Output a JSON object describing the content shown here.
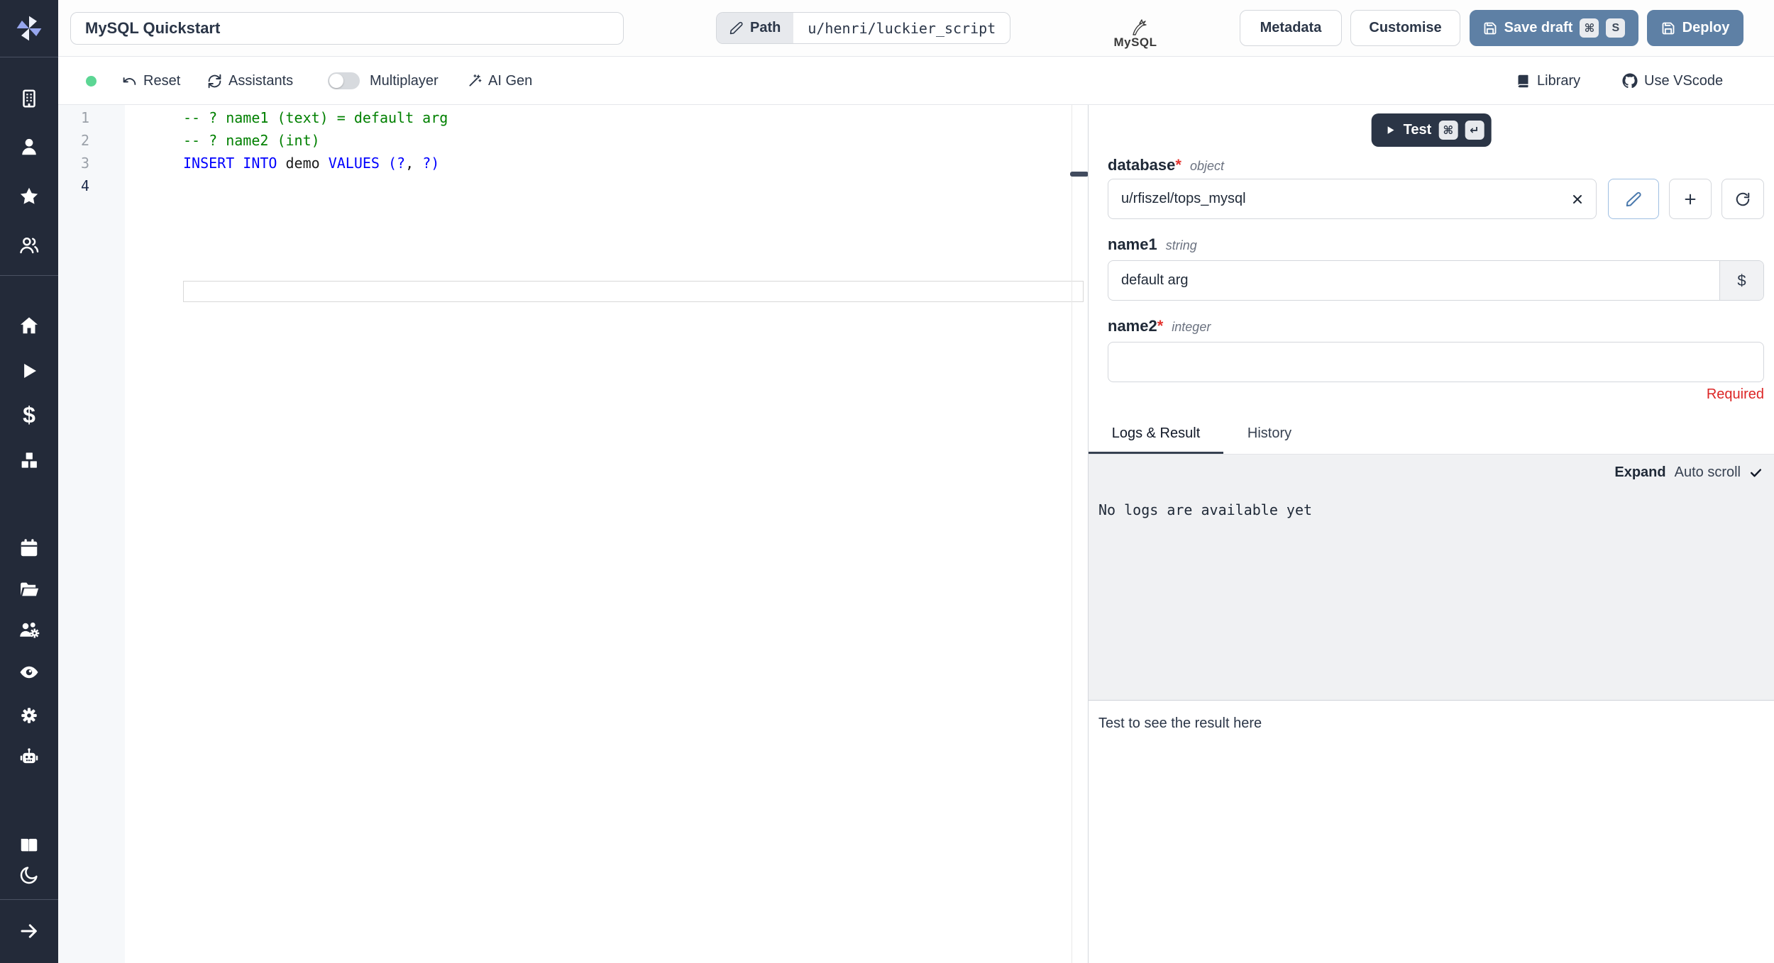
{
  "colors": {
    "accent_blue": "#5e80a5",
    "sidebar_bg": "#232a39",
    "status_dot_green": "#5cd694",
    "comment_green": "#008000",
    "keyword_blue": "#0000ff",
    "required_red": "#dc2626"
  },
  "header": {
    "title_value": "MySQL Quickstart",
    "path_label": "Path",
    "path_value": "u/henri/luckier_script",
    "language_badge": "MySQL",
    "metadata_label": "Metadata",
    "customise_label": "Customise",
    "save_draft_label": "Save draft",
    "save_draft_keys": [
      "⌘",
      "S"
    ],
    "deploy_label": "Deploy"
  },
  "toolbar": {
    "reset_label": "Reset",
    "assistants_label": "Assistants",
    "multiplayer_label": "Multiplayer",
    "multiplayer_on": false,
    "ai_gen_label": "AI Gen",
    "library_label": "Library",
    "vscode_label": "Use VScode"
  },
  "sidebar": {
    "icons": [
      "windmill-logo",
      "building",
      "person",
      "star",
      "users",
      "home",
      "play",
      "dollar",
      "cubes",
      "calendar",
      "folder-open",
      "users-gear",
      "eye",
      "gear",
      "robot",
      "open-book",
      "moon",
      "arrow-right"
    ]
  },
  "editor": {
    "active_line": "4",
    "lines": [
      {
        "number": "1",
        "segments": [
          {
            "tok": "comment",
            "text": "-- ? name1 (text) = default arg"
          }
        ]
      },
      {
        "number": "2",
        "segments": [
          {
            "tok": "comment",
            "text": "-- ? name2 (int)"
          }
        ]
      },
      {
        "number": "3",
        "segments": [
          {
            "tok": "kw",
            "text": "INSERT"
          },
          {
            "tok": "plain",
            "text": " "
          },
          {
            "tok": "kw",
            "text": "INTO"
          },
          {
            "tok": "plain",
            "text": " demo "
          },
          {
            "tok": "kw",
            "text": "VALUES"
          },
          {
            "tok": "plain",
            "text": " "
          },
          {
            "tok": "kw",
            "text": "(?"
          },
          {
            "tok": "plain",
            "text": ", "
          },
          {
            "tok": "kw",
            "text": "?)"
          }
        ]
      },
      {
        "number": "4",
        "segments": []
      }
    ]
  },
  "run_panel": {
    "test_label": "Test",
    "test_keys": [
      "⌘",
      "↵"
    ],
    "fields": [
      {
        "name": "database",
        "required": true,
        "type": "object",
        "value": "u/rfiszel/tops_mysql"
      },
      {
        "name": "name1",
        "required": false,
        "type": "string",
        "value": "default arg",
        "addon": "$"
      },
      {
        "name": "name2",
        "required": true,
        "type": "integer",
        "value": "",
        "error": "Required"
      }
    ],
    "tabs": [
      "Logs & Result",
      "History"
    ],
    "expand_label": "Expand",
    "auto_scroll_label": "Auto scroll",
    "auto_scroll_checked": true,
    "logs_empty": "No logs are available yet",
    "result_placeholder": "Test to see the result here"
  }
}
